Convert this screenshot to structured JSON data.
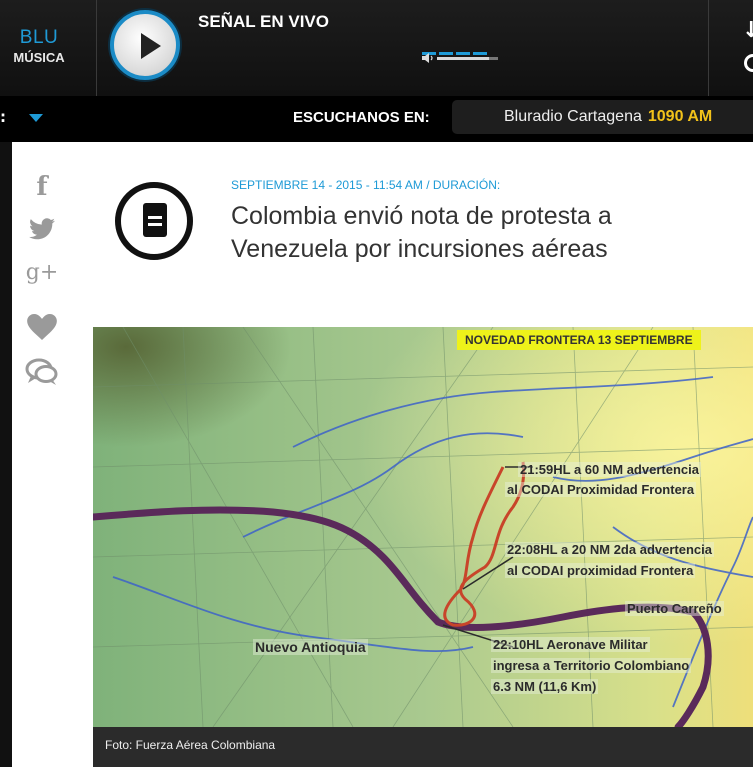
{
  "player": {
    "brand_top": "BLU",
    "brand_bottom": "MÚSICA",
    "live_label": "SEÑAL EN VIVO",
    "volume_level": 0.85
  },
  "listen_bar": {
    "colon": ":",
    "label": "ESCUCHANOS EN:",
    "station_name": "Bluradio Cartagena",
    "station_freq": "1090 AM"
  },
  "share_icons": [
    "facebook-icon",
    "twitter-icon",
    "google-plus-icon",
    "heart-icon",
    "comment-icon"
  ],
  "share": {
    "google_plus_text": "g+"
  },
  "article": {
    "date_line": "SEPTIEMBRE 14 - 2015 - 11:54 AM / DURACIÓN:",
    "title": "Colombia envió nota de protesta a Venezuela por incursiones aéreas"
  },
  "photo": {
    "map_title": "NOVEDAD FRONTERA 13 SEPTIEMBRE",
    "labels": {
      "l1_a": "21:59HL a 60 NM advertencia",
      "l1_b": "al CODAI Proximidad Frontera",
      "l2_a": "22:08HL a 20 NM 2da advertencia",
      "l2_b": "al CODAI proximidad Frontera",
      "puerto": "Puerto Carreño",
      "nuevo": "Nuevo Antioquia",
      "l3_a": "22:10HL      Aeronave      Militar",
      "l3_b": "ingresa a Territorio Colombiano",
      "l3_c": "6.3 NM (11,6 Km)"
    },
    "caption": "Foto: Fuerza Aérea Colombiana"
  },
  "colors": {
    "accent_blue": "#1e9ad6",
    "freq_yellow": "#f2c21a",
    "title_banner": "#eef21a"
  }
}
